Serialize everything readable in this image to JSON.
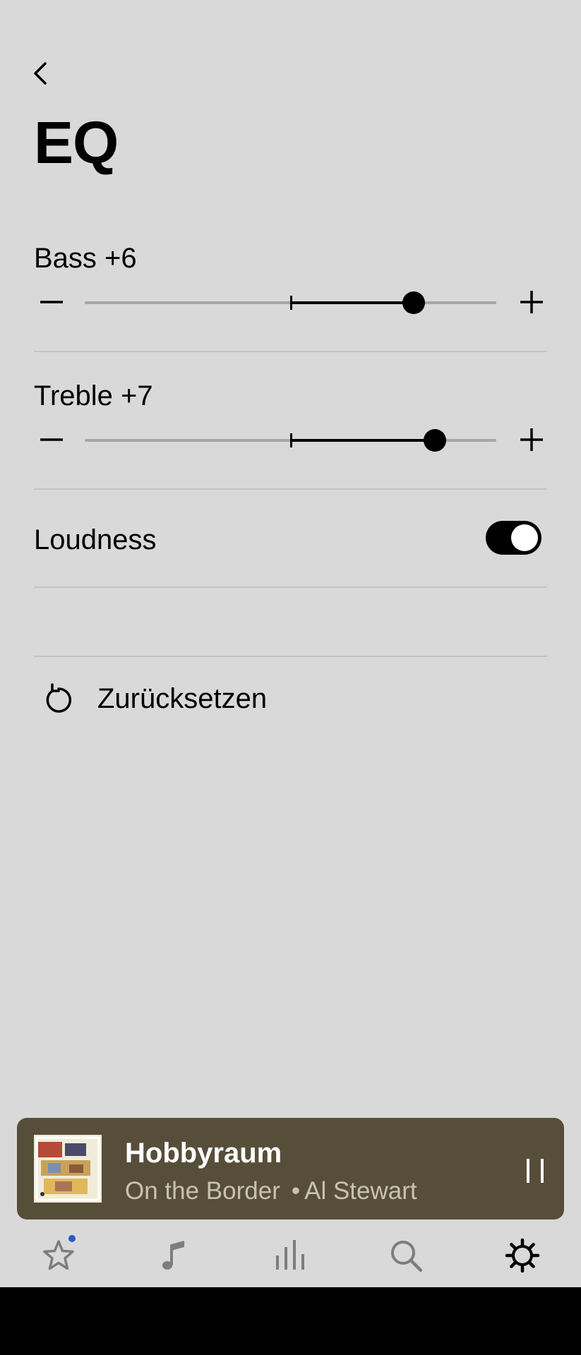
{
  "header": {
    "title": "EQ"
  },
  "bass": {
    "label": "Bass +6",
    "value": 6,
    "min": -10,
    "max": 10
  },
  "treble": {
    "label": "Treble +7",
    "value": 7,
    "min": -10,
    "max": 10
  },
  "loudness": {
    "label": "Loudness",
    "enabled": true
  },
  "reset": {
    "label": "Zurücksetzen"
  },
  "now_playing": {
    "room": "Hobbyraum",
    "track": "On the Border",
    "separator": "•",
    "artist": "Al Stewart"
  },
  "bottom_nav": [
    {
      "icon": "star-icon",
      "active": false,
      "badge": true
    },
    {
      "icon": "music-note-icon",
      "active": false
    },
    {
      "icon": "equalizer-bars-icon",
      "active": false
    },
    {
      "icon": "search-icon",
      "active": false
    },
    {
      "icon": "settings-gear-icon",
      "active": true
    }
  ],
  "colors": {
    "background": "#d9d9d9",
    "now_playing_bg": "#574e3a",
    "badge": "#2f57c7"
  }
}
